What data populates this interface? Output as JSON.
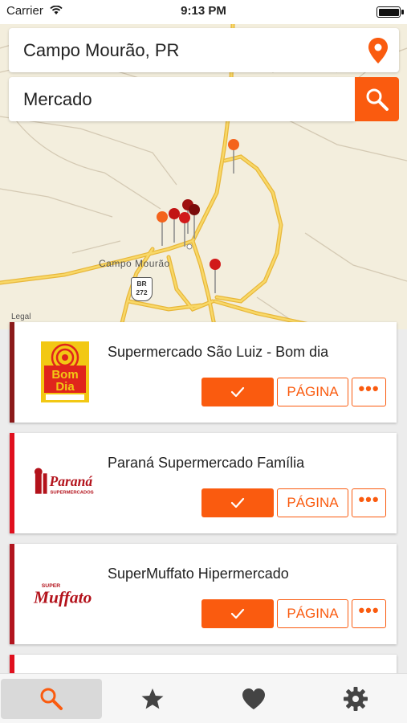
{
  "status_bar": {
    "carrier": "Carrier",
    "time": "9:13 PM"
  },
  "location_field": {
    "value": "Campo Mourão, PR",
    "icon": "location-pin-icon"
  },
  "search_field": {
    "value": "Mercado",
    "button_icon": "search-icon"
  },
  "map": {
    "city_label": "Campo Mourão",
    "route_shield": {
      "line1": "BR",
      "line2": "272"
    },
    "legal": "Legal"
  },
  "results": [
    {
      "name": "Supermercado São Luiz - Bom dia",
      "logo": "bom-dia-logo",
      "bar_color": "#8b1a1a",
      "page_label": "PÁGINA",
      "more_label": "•••"
    },
    {
      "name": "Paraná Supermercado Família",
      "logo": "parana-logo",
      "bar_color": "#e0101e",
      "page_label": "PÁGINA",
      "more_label": "•••"
    },
    {
      "name": "SuperMuffato Hipermercado",
      "logo": "muffato-logo",
      "bar_color": "#b2151f",
      "page_label": "PÁGINA",
      "more_label": "•••"
    }
  ],
  "tabs": [
    {
      "icon": "search-icon",
      "active": true
    },
    {
      "icon": "star-icon",
      "active": false
    },
    {
      "icon": "heart-icon",
      "active": false
    },
    {
      "icon": "gear-icon",
      "active": false
    }
  ],
  "colors": {
    "accent": "#fa5b0f",
    "map_bg": "#f3eedd",
    "road": "#f5c442"
  }
}
